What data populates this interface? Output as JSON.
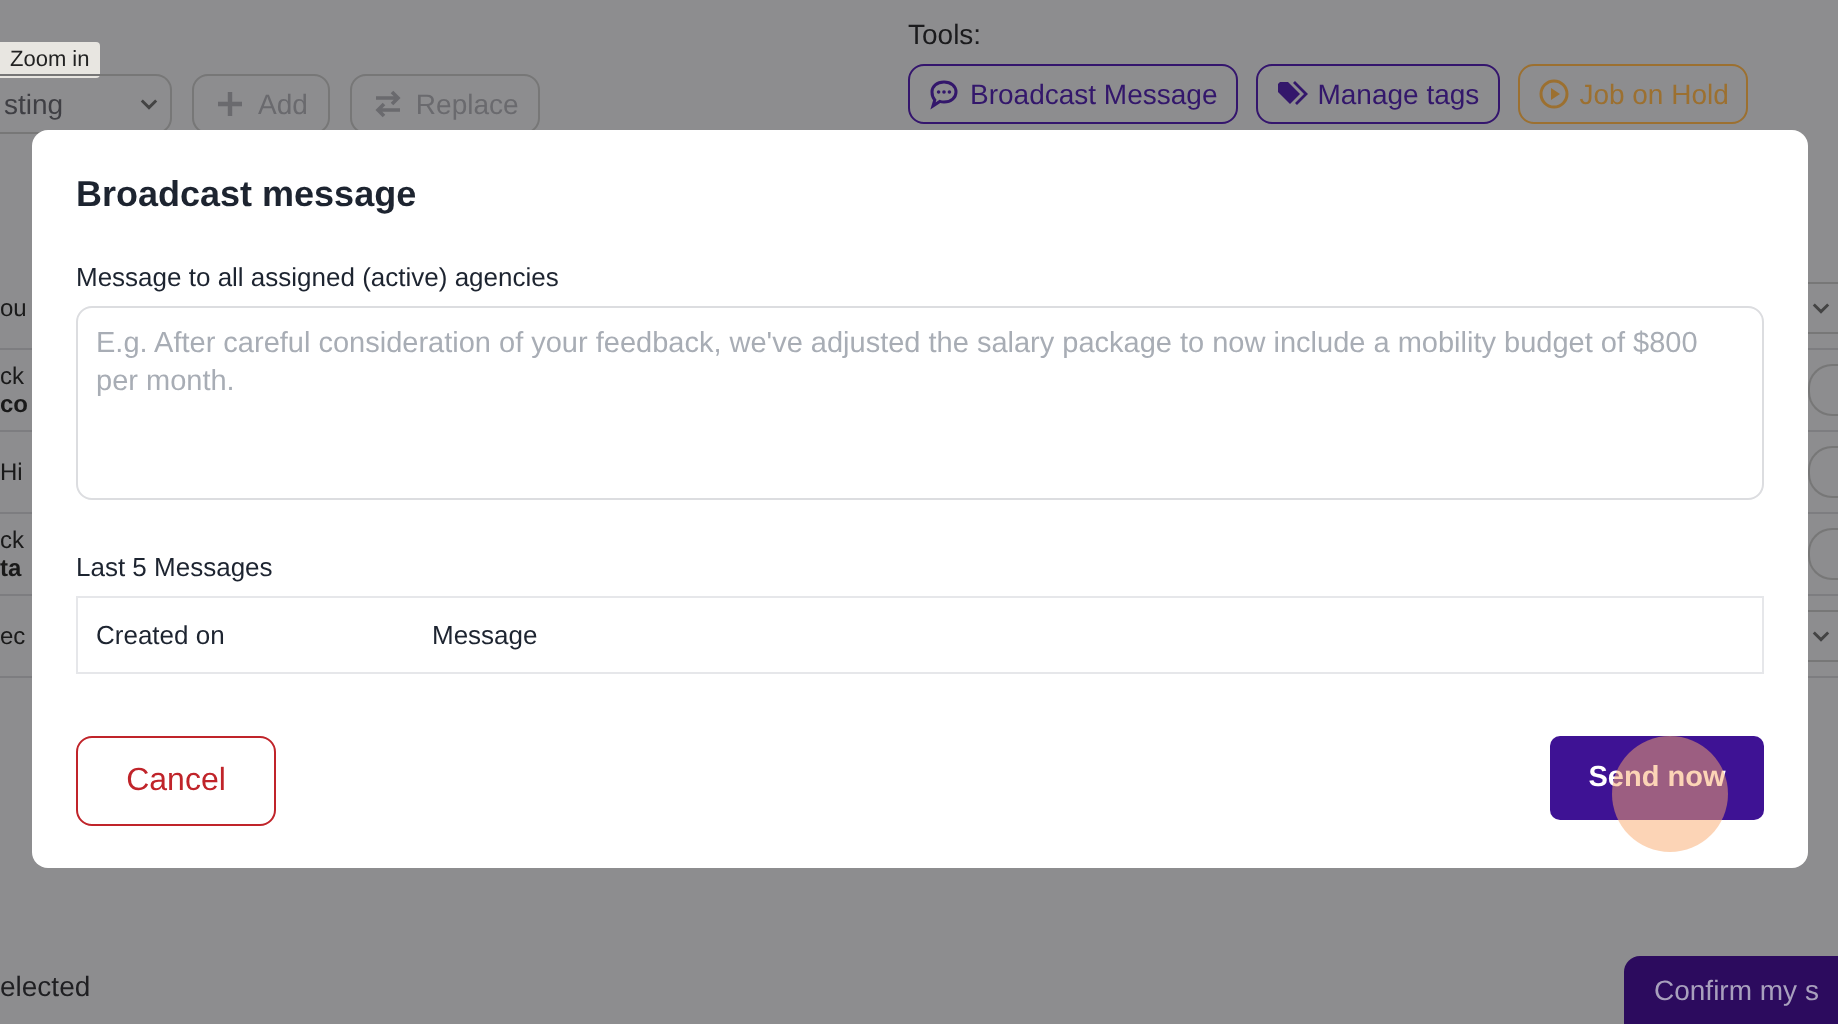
{
  "tooltip": {
    "text": "Zoom in"
  },
  "toolbar": {
    "select_value": "sting",
    "buttons": [
      {
        "label": "Add"
      },
      {
        "label": "Replace"
      }
    ]
  },
  "tools": {
    "label": "Tools:",
    "buttons": [
      {
        "label": "Broadcast Message",
        "kind": "primary"
      },
      {
        "label": "Manage tags",
        "kind": "primary"
      },
      {
        "label": "Job on Hold",
        "kind": "warning"
      }
    ]
  },
  "background_rows": [
    {
      "lines": [
        "ou"
      ],
      "kind": "dropdown"
    },
    {
      "lines": [
        "ck",
        "co"
      ],
      "kind": "button"
    },
    {
      "lines": [
        "Hi"
      ],
      "kind": "button"
    },
    {
      "lines": [
        "ck",
        "ta"
      ],
      "kind": "button"
    },
    {
      "lines": [
        "ec"
      ],
      "kind": "dropdown"
    }
  ],
  "footer": {
    "selection_text": "elected",
    "confirm_label": "Confirm my s"
  },
  "modal": {
    "title": "Broadcast message",
    "message_label": "Message to all assigned (active) agencies",
    "message_placeholder": "E.g. After careful consideration of your feedback, we've adjusted the salary package to now include a mobility budget of $800 per month.",
    "history_label": "Last 5 Messages",
    "history_columns": [
      "Created on",
      "Message"
    ],
    "cancel_label": "Cancel",
    "send_label": "Send now",
    "send_clicked": true
  }
}
